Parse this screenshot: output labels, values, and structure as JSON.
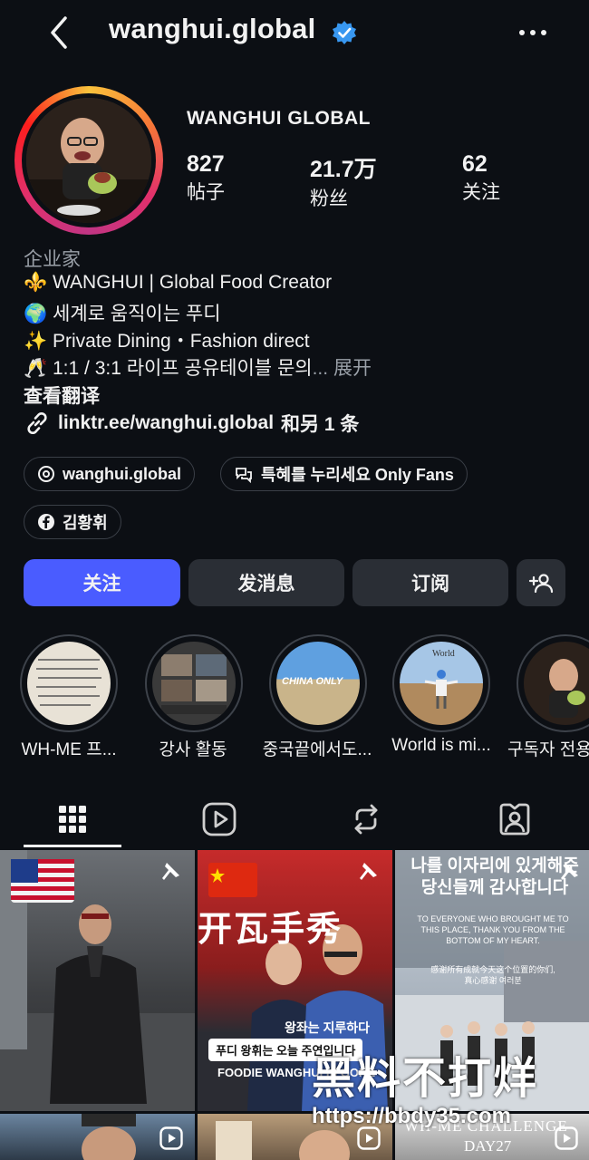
{
  "header": {
    "handle": "wanghui.global",
    "back_icon": "chevron-left-icon",
    "verified_icon": "verified-badge-icon",
    "more_icon": "more-horizontal-icon"
  },
  "profile": {
    "display_name": "WANGHUI GLOBAL",
    "stats": [
      {
        "value": "827",
        "label": "帖子"
      },
      {
        "value": "21.7万",
        "label": "粉丝"
      },
      {
        "value": "62",
        "label": "关注"
      }
    ],
    "category": "企业家",
    "bio": [
      {
        "emoji": "⚜️",
        "text": "WANGHUI | Global Food Creator"
      },
      {
        "emoji": "🌍",
        "text": "세계로 움직이는 푸디"
      },
      {
        "emoji": "✨",
        "text": "Private Dining・Fashion direct"
      },
      {
        "emoji": "🥂",
        "text": "1:1 / 3:1 라이프 공유테이블 문의",
        "ellipsis": "...",
        "more": "展开"
      }
    ],
    "translate": "查看翻译",
    "link": {
      "url": "linktr.ee/wanghui.global",
      "suffix": "和另 1 条"
    }
  },
  "chips": [
    {
      "icon": "threads-icon",
      "label": "wanghui.global"
    },
    {
      "icon": "chat-bubbles-icon",
      "label": "특혜를 누리세요 Only Fans"
    },
    {
      "icon": "facebook-icon",
      "label": "김황휘"
    }
  ],
  "actions": {
    "follow": "关注",
    "message": "发消息",
    "subscribe": "订阅",
    "add_person_icon": "add-person-icon"
  },
  "highlights": [
    {
      "label": "WH-ME 프..."
    },
    {
      "label": "강사 활동"
    },
    {
      "label": "중국끝에서도..."
    },
    {
      "label": "World is mi..."
    },
    {
      "label": "구독자 전용"
    }
  ],
  "highlight_overlays": {
    "china_only": "CHINA ONLY",
    "world": "World"
  },
  "tabs": [
    {
      "icon": "grid-icon",
      "active": true
    },
    {
      "icon": "reels-icon",
      "active": false
    },
    {
      "icon": "repost-icon",
      "active": false
    },
    {
      "icon": "tagged-icon",
      "active": false
    }
  ],
  "posts": {
    "p2_big": "开瓦手秀",
    "p2_caption1": "왕좌는 지루하다",
    "p2_caption2": "푸디 왕휘는 오늘 주연입니다",
    "p2_caption3": "FOODIE WANGHUI IS GONE",
    "p3_title1": "나를 이자리에 있게해준",
    "p3_title2": "당신들께 감사합니다",
    "p3_en": "TO EVERYONE WHO BROUGHT ME TO THIS PLACE, THANK YOU FROM THE BOTTOM OF MY HEART.",
    "p3_cn1": "感谢所有成就今天这个位置的你们,",
    "p3_cn2": "真心感谢 여러분",
    "p6_text1": "WH-ME CHALLENGE",
    "p6_text2": "DAY27"
  },
  "watermark": {
    "brand": "黑料不打烊",
    "url": "https://bbdy35.com"
  },
  "colors": {
    "background": "#0c0f14",
    "primary_button": "#4a5cff",
    "dark_button": "#2a2e35",
    "verified": "#3897f0"
  }
}
